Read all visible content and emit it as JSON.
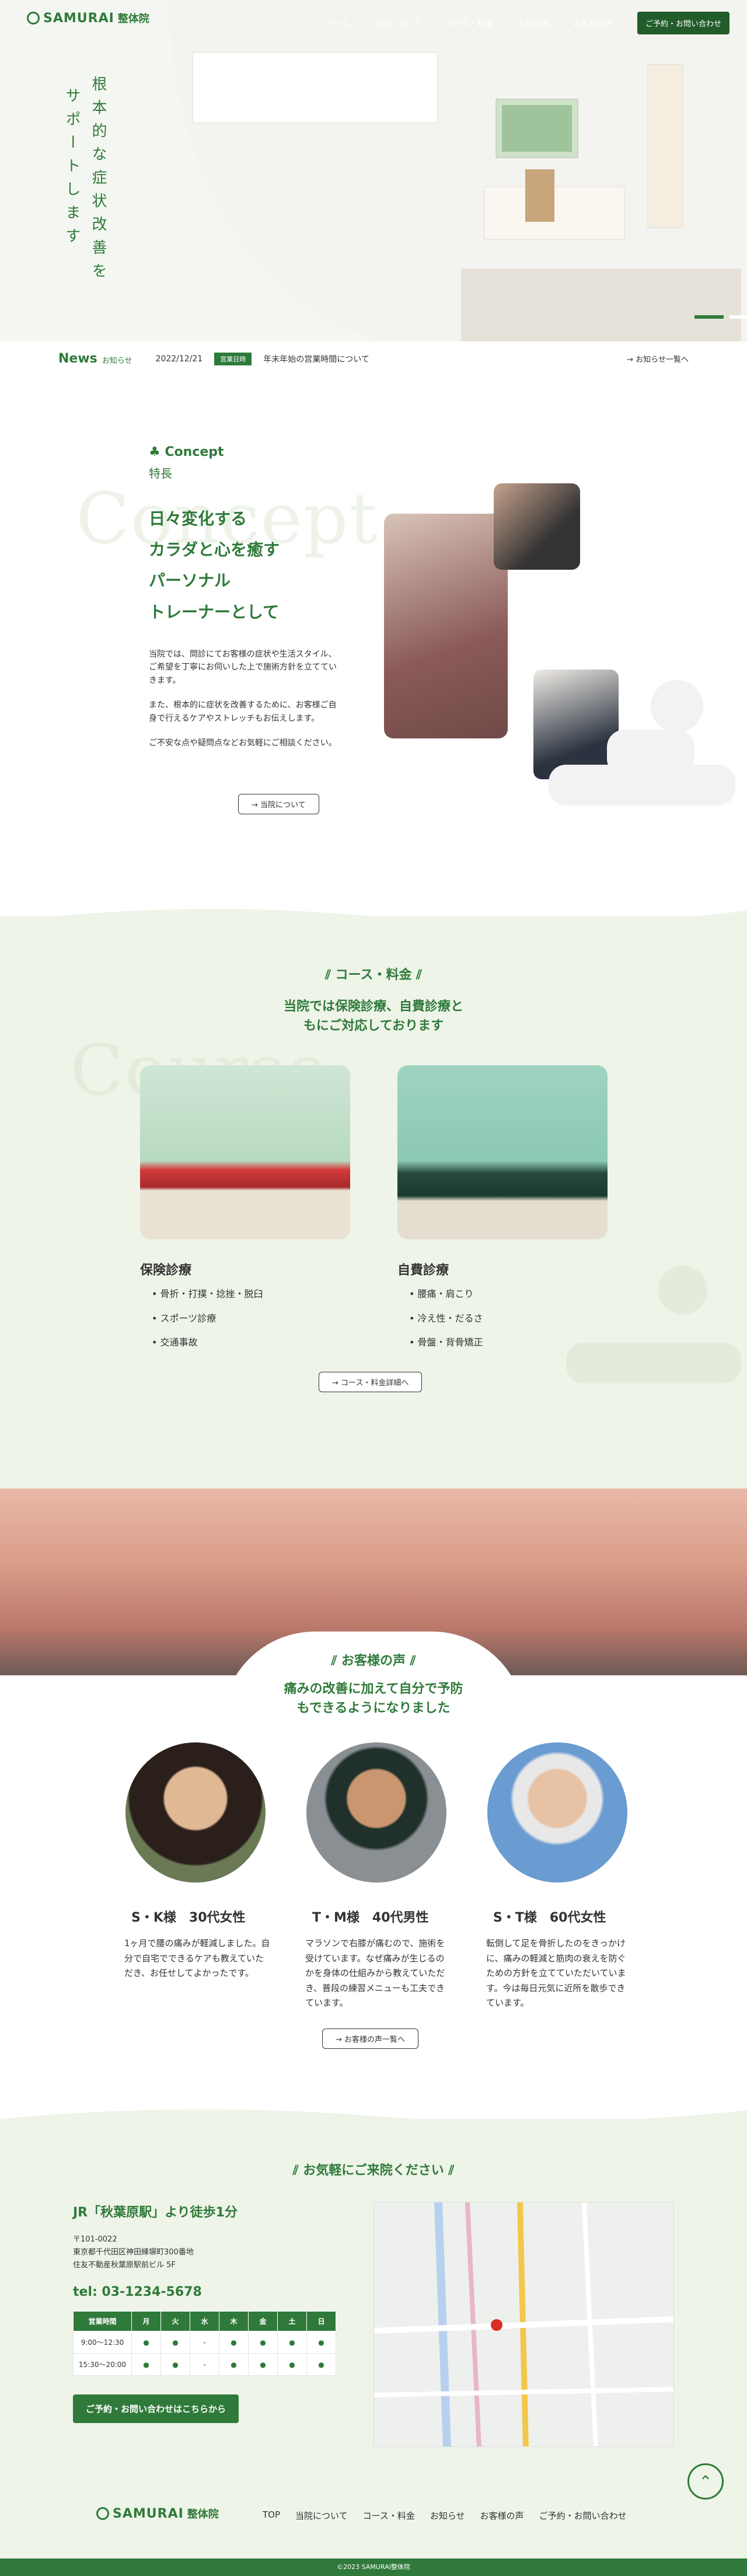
{
  "brand": {
    "name": "SAMURAI",
    "suffix": "整体院"
  },
  "nav": {
    "items": [
      "ホーム",
      "当院について",
      "コース・料金",
      "お知らせ",
      "お客様の声"
    ],
    "cta": "ご予約・お問い合わせ"
  },
  "hero": {
    "catch_col1": "根本的な症状改善を",
    "catch_col2": "サポートします"
  },
  "news": {
    "heading": "News",
    "heading_sub": "お知らせ",
    "date": "2022/12/21",
    "tag": "営業日時",
    "title": "年末年始の営業時間について",
    "link": "→ お知らせ一覧へ"
  },
  "concept": {
    "label": "Concept",
    "label_sub": "特長",
    "ghost": "Concept",
    "headline": [
      "日々変化する",
      "カラダと心を癒す",
      "パーソナル",
      "トレーナーとして"
    ],
    "p1": "当院では、問診にてお客様の症状や生活スタイル、ご希望を丁寧にお伺いした上で施術方針を立てていきます。",
    "p2": "また、根本的に症状を改善するために、お客様ご自身で行えるケアやストレッチもお伝えします。",
    "p3": "ご不安な点や疑問点などお気軽にご相談ください。",
    "button": "→ 当院について"
  },
  "course": {
    "title": "コース・料金",
    "sub1": "当院では保険診療、自費診療と",
    "sub2": "もにご対応しております",
    "ghost": "Course",
    "insurance": {
      "title": "保険診療",
      "items": [
        "骨折・打撲・捻挫・脱臼",
        "スポーツ診療",
        "交通事故"
      ]
    },
    "private": {
      "title": "自費診療",
      "items": [
        "腰痛・肩こり",
        "冷え性・だるさ",
        "骨盤・背骨矯正"
      ]
    },
    "button": "→ コース・料金詳細へ"
  },
  "voice": {
    "title": "お客様の声",
    "sub1": "痛みの改善に加えて自分で予防",
    "sub2": "もできるようになりました",
    "items": [
      {
        "name": "S・K様　30代女性",
        "text": "1ヶ月で腰の痛みが軽減しました。自分で自宅でできるケアも教えていただき、お任せしてよかったです。"
      },
      {
        "name": "T・M様　40代男性",
        "text": "マラソンで右膝が痛むので、施術を受けています。なぜ痛みが生じるのかを身体の仕組みから教えていただき、普段の練習メニューも工夫できています。"
      },
      {
        "name": "S・T様　60代女性",
        "text": "転倒して足を骨折したのをきっかけに、痛みの軽減と筋肉の衰えを防ぐための方針を立てていただいています。今は毎日元気に近所を散歩できています。"
      }
    ],
    "button": "→ お客様の声一覧へ"
  },
  "access": {
    "title": "お気軽にご来院ください",
    "station": "JR「秋葉原駅」より徒歩1分",
    "zip": "〒101-0022",
    "addr1": "東京都千代田区神田練塀町300番地",
    "addr2": "住友不動産秋葉原駅前ビル 5F",
    "tel": "tel: 03-1234-5678",
    "table_head": [
      "営業時間",
      "月",
      "火",
      "水",
      "木",
      "金",
      "土",
      "日"
    ],
    "rows": [
      {
        "time": "9:00〜12:30",
        "marks": [
          "●",
          "●",
          "-",
          "●",
          "●",
          "●",
          "●"
        ]
      },
      {
        "time": "15:30〜20:00",
        "marks": [
          "●",
          "●",
          "-",
          "●",
          "●",
          "●",
          "●"
        ]
      }
    ],
    "cta": "ご予約・お問い合わせはこちらから"
  },
  "footer": {
    "nav": [
      "TOP",
      "当院について",
      "コース・料金",
      "お知らせ",
      "お客様の声",
      "ご予約・お問い合わせ"
    ],
    "copyright": "©2023 SAMURAI整体院"
  },
  "colors": {
    "accent": "#2f7a3a",
    "bg_light": "#eef4e8",
    "dark_cta": "#225c2a"
  }
}
